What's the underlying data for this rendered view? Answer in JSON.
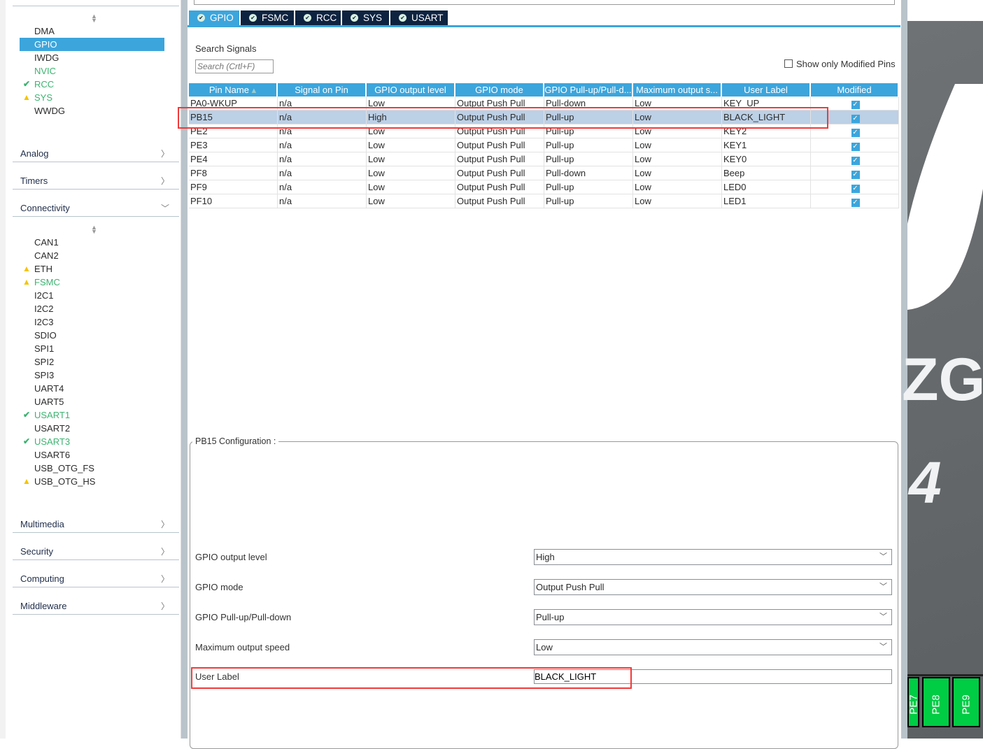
{
  "sidebar": {
    "system_items": [
      {
        "label": "DMA",
        "state": "none"
      },
      {
        "label": "GPIO",
        "state": "selected"
      },
      {
        "label": "IWDG",
        "state": "none"
      },
      {
        "label": "NVIC",
        "state": "green"
      },
      {
        "label": "RCC",
        "state": "ok"
      },
      {
        "label": "SYS",
        "state": "warn"
      },
      {
        "label": "WWDG",
        "state": "none"
      }
    ],
    "sections_top": [
      {
        "label": "Analog",
        "chevron": "right"
      },
      {
        "label": "Timers",
        "chevron": "right"
      },
      {
        "label": "Connectivity",
        "chevron": "down"
      }
    ],
    "connectivity_items": [
      {
        "label": "CAN1",
        "state": "none"
      },
      {
        "label": "CAN2",
        "state": "none"
      },
      {
        "label": "ETH",
        "state": "warn-plain"
      },
      {
        "label": "FSMC",
        "state": "warn"
      },
      {
        "label": "I2C1",
        "state": "none"
      },
      {
        "label": "I2C2",
        "state": "none"
      },
      {
        "label": "I2C3",
        "state": "none"
      },
      {
        "label": "SDIO",
        "state": "none"
      },
      {
        "label": "SPI1",
        "state": "none"
      },
      {
        "label": "SPI2",
        "state": "none"
      },
      {
        "label": "SPI3",
        "state": "none"
      },
      {
        "label": "UART4",
        "state": "none"
      },
      {
        "label": "UART5",
        "state": "none"
      },
      {
        "label": "USART1",
        "state": "ok"
      },
      {
        "label": "USART2",
        "state": "none"
      },
      {
        "label": "USART3",
        "state": "ok"
      },
      {
        "label": "USART6",
        "state": "none"
      },
      {
        "label": "USB_OTG_FS",
        "state": "none"
      },
      {
        "label": "USB_OTG_HS",
        "state": "warn-plain"
      }
    ],
    "sections_bottom": [
      {
        "label": "Multimedia"
      },
      {
        "label": "Security"
      },
      {
        "label": "Computing"
      },
      {
        "label": "Middleware"
      }
    ]
  },
  "tabs": [
    {
      "label": "GPIO",
      "active": true
    },
    {
      "label": "FSMC"
    },
    {
      "label": "RCC"
    },
    {
      "label": "SYS"
    },
    {
      "label": "USART"
    }
  ],
  "search": {
    "label": "Search Signals",
    "placeholder": "Search (Crtl+F)",
    "show_modified_label": "Show only Modified Pins",
    "show_modified_checked": false
  },
  "table": {
    "columns": [
      "Pin Name",
      "Signal on Pin",
      "GPIO output level",
      "GPIO mode",
      "GPIO Pull-up/Pull-d...",
      "Maximum output s...",
      "User Label",
      "Modified"
    ],
    "sort_column": "Pin Name",
    "selected_row": 1,
    "rows": [
      [
        "PA0-WKUP",
        "n/a",
        "Low",
        "Output Push Pull",
        "Pull-down",
        "Low",
        "KEY_UP",
        true
      ],
      [
        "PB15",
        "n/a",
        "High",
        "Output Push Pull",
        "Pull-up",
        "Low",
        "BLACK_LIGHT",
        true
      ],
      [
        "PE2",
        "n/a",
        "Low",
        "Output Push Pull",
        "Pull-up",
        "Low",
        "KEY2",
        true
      ],
      [
        "PE3",
        "n/a",
        "Low",
        "Output Push Pull",
        "Pull-up",
        "Low",
        "KEY1",
        true
      ],
      [
        "PE4",
        "n/a",
        "Low",
        "Output Push Pull",
        "Pull-up",
        "Low",
        "KEY0",
        true
      ],
      [
        "PF8",
        "n/a",
        "Low",
        "Output Push Pull",
        "Pull-down",
        "Low",
        "Beep",
        true
      ],
      [
        "PF9",
        "n/a",
        "Low",
        "Output Push Pull",
        "Pull-up",
        "Low",
        "LED0",
        true
      ],
      [
        "PF10",
        "n/a",
        "Low",
        "Output Push Pull",
        "Pull-up",
        "Low",
        "LED1",
        true
      ]
    ]
  },
  "config": {
    "title": "PB15 Configuration :",
    "fields": [
      {
        "label": "GPIO output level",
        "value": "High"
      },
      {
        "label": "GPIO mode",
        "value": "Output Push Pull"
      },
      {
        "label": "GPIO Pull-up/Pull-down",
        "value": "Pull-up"
      },
      {
        "label": "Maximum output speed",
        "value": "Low"
      }
    ],
    "user_label": {
      "label": "User Label",
      "value": "BLACK_LIGHT"
    }
  },
  "chip": {
    "logo_text": "ZG",
    "model_digit": "4",
    "pins": [
      "PE7",
      "PE8",
      "PE9"
    ]
  },
  "colors": {
    "accent": "#3ca5dc",
    "tab_dark": "#0d2340",
    "ok": "#3cb371",
    "warn": "#f5c400",
    "highlight": "#f03a3a",
    "pin_green": "#00cc44"
  }
}
